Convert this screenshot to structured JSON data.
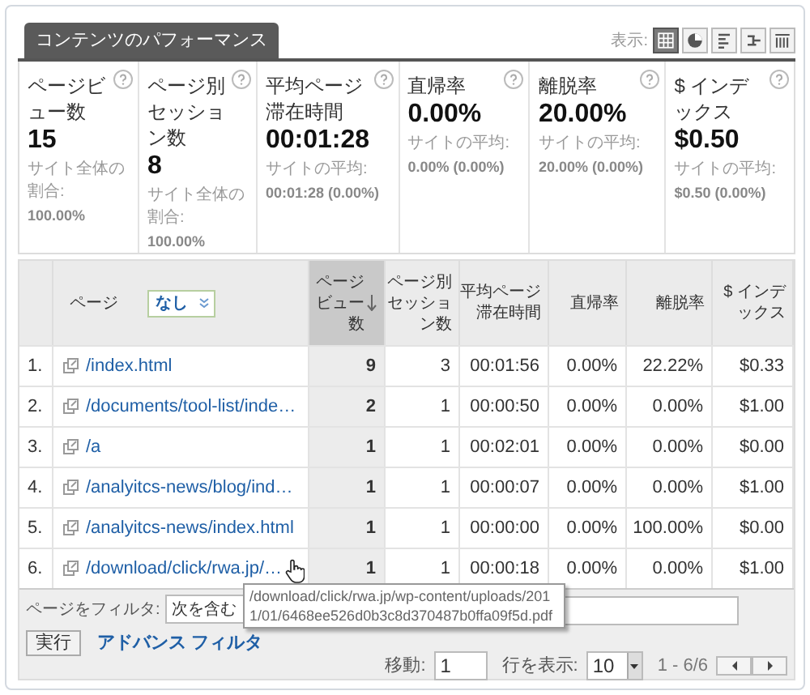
{
  "tab": {
    "label": "コンテンツのパフォーマンス"
  },
  "view": {
    "label": "表示:",
    "options": [
      {
        "kind": "table",
        "selected": true
      },
      {
        "kind": "pie",
        "selected": false
      },
      {
        "kind": "bars",
        "selected": false
      },
      {
        "kind": "compare",
        "selected": false
      },
      {
        "kind": "pivot",
        "selected": false
      }
    ]
  },
  "metrics": [
    {
      "label": "ページビュー数",
      "value": "15",
      "note_label": "サイト全体の割合:",
      "note_value": "100.00%"
    },
    {
      "label": "ページ別セッション数",
      "value": "8",
      "note_label": "サイト全体の割合:",
      "note_value": "100.00%"
    },
    {
      "label": "平均ページ滞在時間",
      "value": "00:01:28",
      "note_label": "サイトの平均:",
      "note_value": "00:01:28 (0.00%)"
    },
    {
      "label": "直帰率",
      "value": "0.00%",
      "note_label": "サイトの平均:",
      "note_value": "0.00% (0.00%)"
    },
    {
      "label": "離脱率",
      "value": "20.00%",
      "note_label": "サイトの平均:",
      "note_value": "20.00% (0.00%)"
    },
    {
      "label": "$ インデックス",
      "value": "$0.50",
      "note_label": "サイトの平均:",
      "note_value": "$0.50 (0.00%)"
    }
  ],
  "table": {
    "page_column": {
      "label": "ページ",
      "secondary_dimension": "なし"
    },
    "columns": [
      {
        "label": "ページビュー数",
        "sorted": true
      },
      {
        "label": "ページ別セッション数",
        "sorted": false
      },
      {
        "label": "平均ページ滞在時間",
        "sorted": false
      },
      {
        "label": "直帰率",
        "sorted": false
      },
      {
        "label": "離脱率",
        "sorted": false
      },
      {
        "label": "$ インデックス",
        "sorted": false
      }
    ],
    "rows": [
      {
        "index": "1.",
        "page": "/index.html",
        "values": [
          "9",
          "3",
          "00:01:56",
          "0.00%",
          "22.22%",
          "$0.33"
        ]
      },
      {
        "index": "2.",
        "page": "/documents/tool-list/inde…",
        "values": [
          "2",
          "1",
          "00:00:50",
          "0.00%",
          "0.00%",
          "$1.00"
        ]
      },
      {
        "index": "3.",
        "page": "/a",
        "values": [
          "1",
          "1",
          "00:02:01",
          "0.00%",
          "0.00%",
          "$0.00"
        ]
      },
      {
        "index": "4.",
        "page": "/analyitcs-news/blog/ind…",
        "values": [
          "1",
          "1",
          "00:00:07",
          "0.00%",
          "0.00%",
          "$1.00"
        ]
      },
      {
        "index": "5.",
        "page": "/analyitcs-news/index.html",
        "values": [
          "1",
          "1",
          "00:00:00",
          "0.00%",
          "100.00%",
          "$0.00"
        ]
      },
      {
        "index": "6.",
        "page": "/download/click/rwa.jp/…",
        "values": [
          "1",
          "1",
          "00:00:18",
          "0.00%",
          "0.00%",
          "$1.00"
        ]
      }
    ]
  },
  "filter": {
    "label": "ページをフィルタ:",
    "condition": "次を含む",
    "apply": "実行",
    "advanced": "アドバンス フィルタ"
  },
  "tooltip": {
    "text": "/download/click/rwa.jp/wp-content/uploads/2011/01/6468ee526d0b3c8d370487b0ffa09f5d.pdf"
  },
  "pagination": {
    "goto_label": "移動:",
    "goto_value": "1",
    "rows_label": "行を表示:",
    "rows_value": "10",
    "range": "1 - 6/6"
  }
}
